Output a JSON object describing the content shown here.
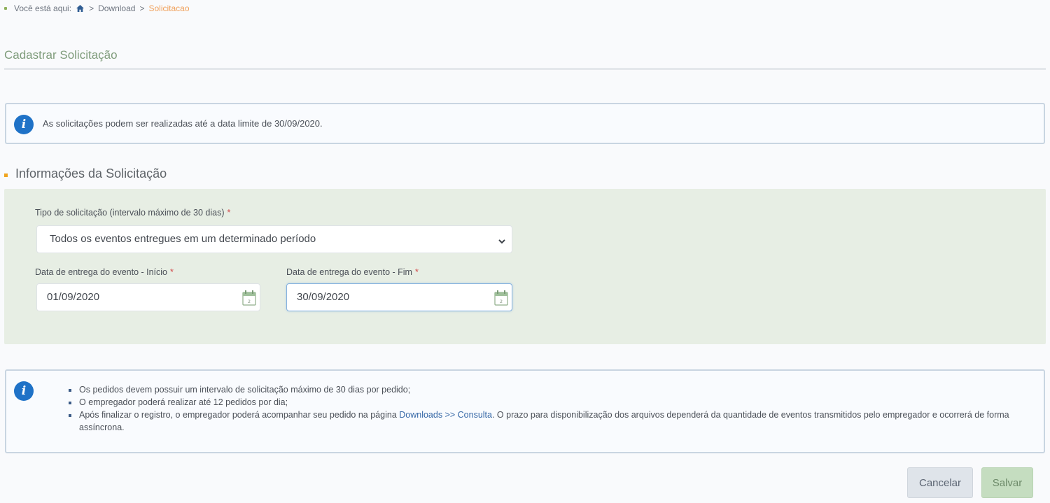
{
  "breadcrumb": {
    "prefix": "Você está aqui:",
    "items": [
      ">",
      "Download",
      ">",
      "Solicitacao"
    ]
  },
  "page_title": "Cadastrar Solicitação",
  "top_alert": {
    "text": "As solicitações podem ser realizadas até a data limite de 30/09/2020."
  },
  "section": {
    "heading": "Informações da Solicitação"
  },
  "form": {
    "tipo_label": "Tipo de solicitação (intervalo máximo de 30 dias)",
    "required_mark": "*",
    "tipo_value": "Todos os eventos entregues em um determinado período",
    "inicio_label": "Data de entrega do evento - Início",
    "inicio_value": "01/09/2020",
    "fim_label": "Data de entrega do evento - Fim",
    "fim_value": "30/09/2020"
  },
  "notes": {
    "item1": "Os pedidos devem possuir um intervalo de solicitação máximo de 30 dias por pedido;",
    "item2": "O empregador poderá realizar até 12 pedidos por dia;",
    "item3_before": "Após finalizar o registro, o empregador poderá acompanhar seu pedido na página ",
    "item3_link": "Downloads >> Consulta",
    "item3_after": ". O prazo para disponibilização dos arquivos dependerá da quantidade de eventos transmitidos pelo empregador e ocorrerá de forma assíncrona."
  },
  "buttons": {
    "cancel": "Cancelar",
    "save": "Salvar"
  },
  "colors": {
    "accent_orange": "#f0a41e",
    "info_blue": "#1f72c7",
    "panel_green": "#e7eee4",
    "title_green": "#7f9c7b"
  },
  "icons": [
    "home-icon",
    "info-icon",
    "chevron-down-icon",
    "calendar-icon"
  ]
}
